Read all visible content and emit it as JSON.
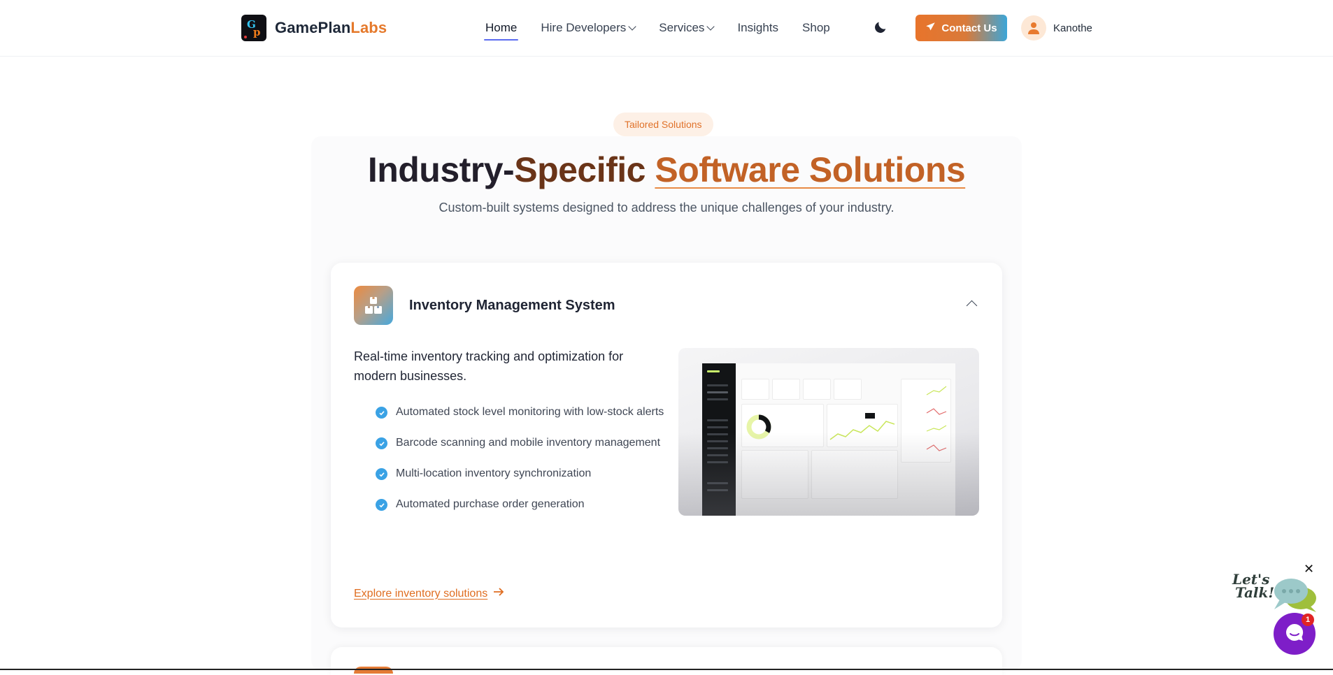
{
  "brand": {
    "name_part1": "GamePlan",
    "name_part2": "Labs",
    "mark_g": "G",
    "mark_p": "p",
    "accent_color": "#e5792b"
  },
  "nav": {
    "items": [
      {
        "label": "Home",
        "active": true,
        "dropdown": false
      },
      {
        "label": "Hire Developers",
        "active": false,
        "dropdown": true
      },
      {
        "label": "Services",
        "active": false,
        "dropdown": true
      },
      {
        "label": "Insights",
        "active": false,
        "dropdown": false
      },
      {
        "label": "Shop",
        "active": false,
        "dropdown": false
      }
    ],
    "theme_icon": "moon-icon",
    "contact_label": "Contact Us",
    "contact_icon": "paper-plane-icon",
    "user_name": "Kanothe",
    "user_icon": "user-icon"
  },
  "hero": {
    "tag": "Tailored Solutions",
    "title_part1": "Industry-",
    "title_part2": "Specific ",
    "title_highlight": "Software Solutions",
    "subtitle": "Custom-built systems designed to address the unique challenges of your industry."
  },
  "card": {
    "icon": "boxes-icon",
    "title": "Inventory Management System",
    "expanded": true,
    "lead": "Real-time inventory tracking and optimization for modern businesses.",
    "features": [
      "Automated stock level monitoring with low-stock alerts",
      "Barcode scanning and mobile inventory management",
      "Multi-location inventory synchronization",
      "Automated purchase order generation"
    ],
    "cta": "Explore inventory solutions",
    "image_alt": "Inventory dashboard preview"
  },
  "chat": {
    "close": "✕",
    "lets_talk_line1": "Let's",
    "lets_talk_line2": "Talk!",
    "badge": "1",
    "color": "#7e1ec8"
  }
}
